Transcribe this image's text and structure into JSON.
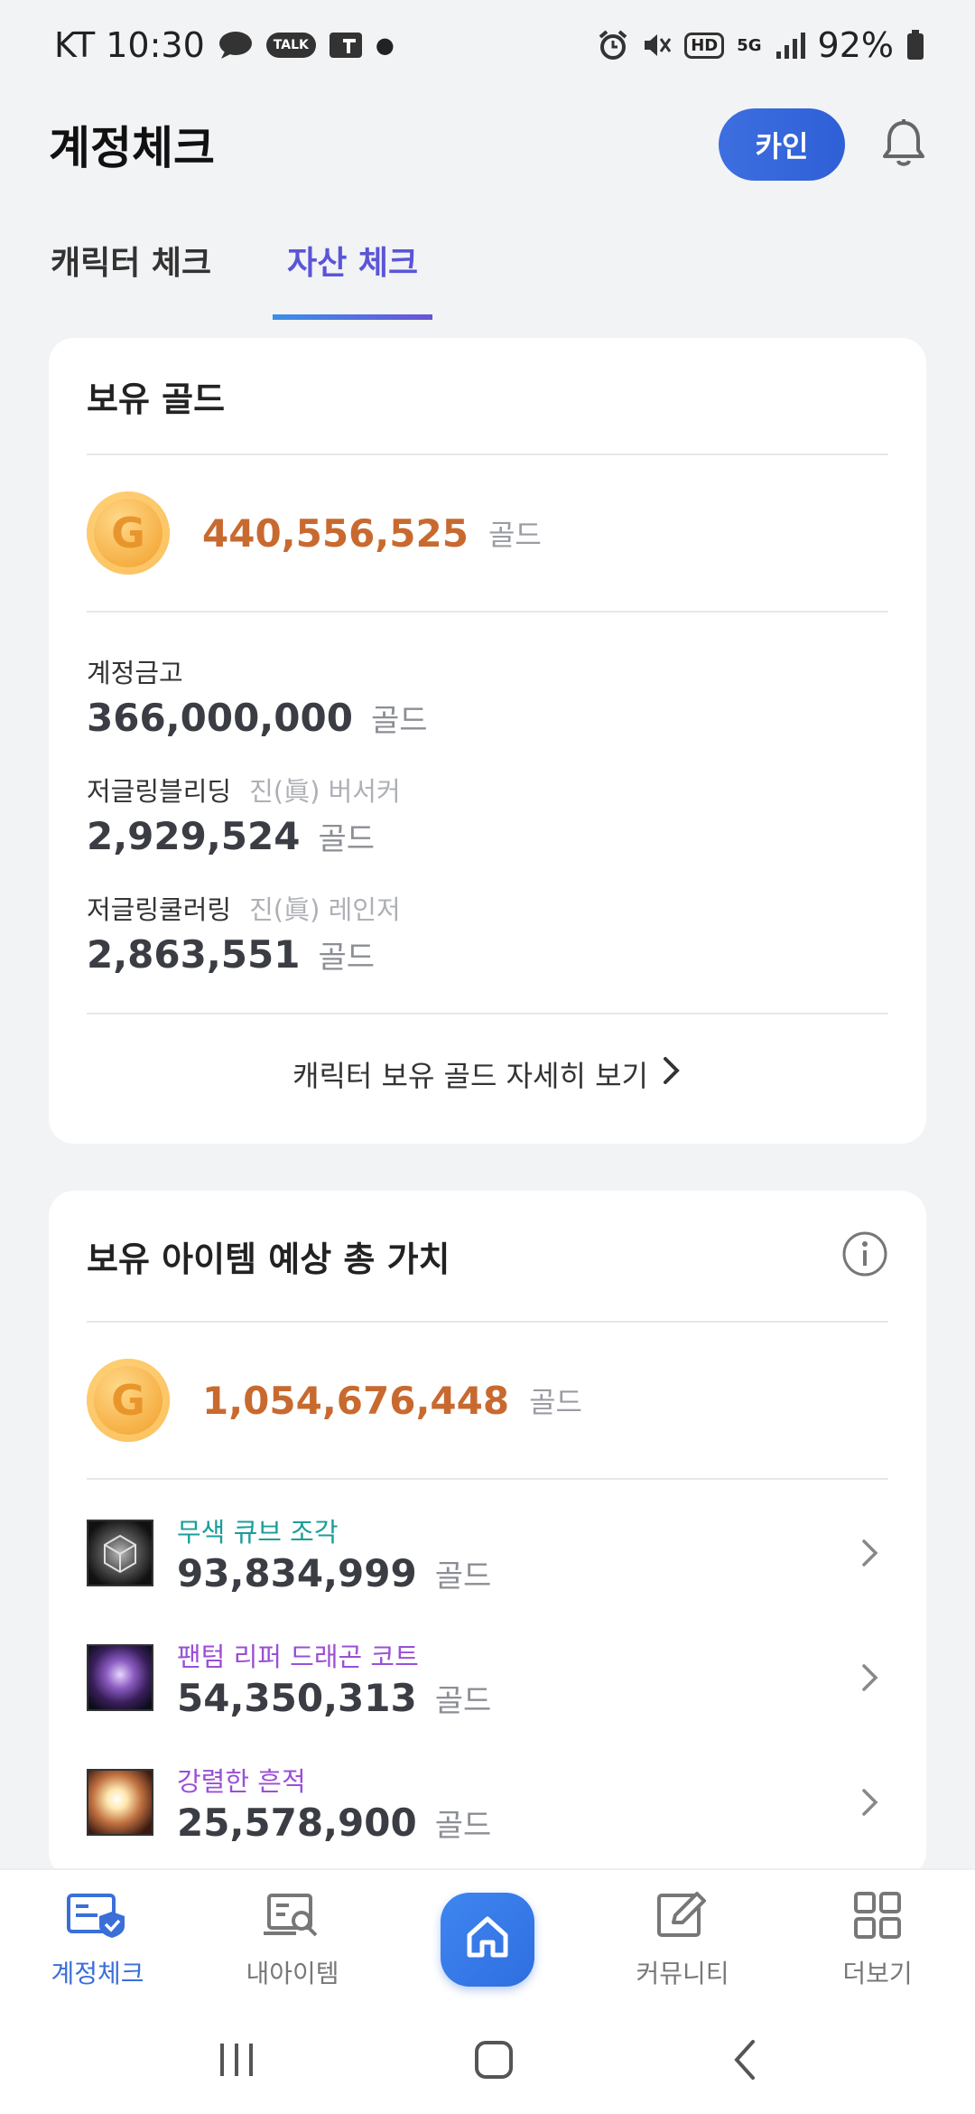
{
  "status_bar": {
    "carrier_time": "KT 10:30",
    "talk_badge": "TALK",
    "hd_badge": "HD",
    "network": "5G",
    "battery": "92%"
  },
  "header": {
    "title": "계정체크",
    "kain_button": "카인",
    "icons": [
      "bell-icon"
    ]
  },
  "tabs": [
    {
      "label": "캐릭터 체크",
      "active": false
    },
    {
      "label": "자산 체크",
      "active": true
    }
  ],
  "gold_card": {
    "title": "보유 골드",
    "coin_letter": "G",
    "total": "440,556,525",
    "unit": "골드",
    "entries": [
      {
        "name": "계정금고",
        "sub": "",
        "amount": "366,000,000",
        "unit": "골드"
      },
      {
        "name": "저글링블리딩",
        "sub": "진(眞) 버서커",
        "amount": "2,929,524",
        "unit": "골드"
      },
      {
        "name": "저글링쿨러링",
        "sub": "진(眞) 레인저",
        "amount": "2,863,551",
        "unit": "골드"
      }
    ],
    "detail_link": "캐릭터 보유 골드 자세히 보기"
  },
  "items_card": {
    "title": "보유 아이템 예상 총 가치",
    "coin_letter": "G",
    "total": "1,054,676,448",
    "unit": "골드",
    "items": [
      {
        "name": "무색 큐브 조각",
        "amount": "93,834,999",
        "unit": "골드",
        "name_color": "#1a9e9a"
      },
      {
        "name": "팬텀 리퍼 드래곤 코트",
        "amount": "54,350,313",
        "unit": "골드",
        "name_color": "#9a4fd6"
      },
      {
        "name": "강렬한 흔적",
        "amount": "25,578,900",
        "unit": "골드",
        "name_color": "#9a4fd6"
      }
    ]
  },
  "bottom_nav": [
    {
      "label": "계정체크",
      "active": true
    },
    {
      "label": "내아이템",
      "active": false
    },
    {
      "label": "",
      "active": false
    },
    {
      "label": "커뮤니티",
      "active": false
    },
    {
      "label": "더보기",
      "active": false
    }
  ],
  "colors": {
    "accent": "#3a6fd8",
    "gold_text": "#c86a30",
    "tab_active": "#5a55d8"
  }
}
